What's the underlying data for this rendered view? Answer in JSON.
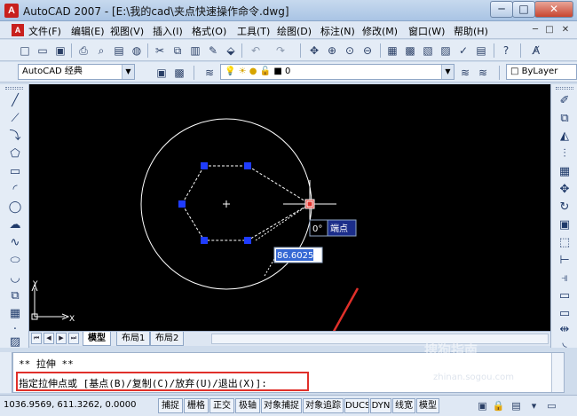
{
  "window": {
    "title": "AutoCAD 2007 - [E:\\我的cad\\夹点快速操作命令.dwg]",
    "logo": "A",
    "minimize": "─",
    "maximize": "□",
    "close": "✕"
  },
  "menubar": {
    "doc_icon": "A",
    "items": [
      "文件(F)",
      "编辑(E)",
      "视图(V)",
      "插入(I)",
      "格式(O)",
      "工具(T)",
      "绘图(D)",
      "标注(N)",
      "修改(M)",
      "窗口(W)",
      "帮助(H)"
    ],
    "mdi_minimize": "─",
    "mdi_restore": "□",
    "mdi_close": "✕"
  },
  "toolbar2": {
    "workspace": "AutoCAD 经典",
    "layer": "0",
    "linetype": "ByLayer"
  },
  "drawing": {
    "dimension_value": "86.6025",
    "angle_value": "0°",
    "snap_tooltip": "端点",
    "ucs_x": "X",
    "ucs_y": "Y"
  },
  "layout_tabs": [
    "模型",
    "布局1",
    "布局2"
  ],
  "command": {
    "line1": "** 拉伸 **",
    "line2": "指定拉伸点或 [基点(B)/复制(C)/放弃(U)/退出(X)]:"
  },
  "status": {
    "coords": "1036.9569, 611.3262, 0.0000",
    "buttons": [
      "捕捉",
      "栅格",
      "正交",
      "极轴",
      "对象捕捉",
      "对象追踪",
      "DUCS",
      "DYN",
      "线宽",
      "模型"
    ]
  },
  "watermark": {
    "text": "搜狗指南",
    "sub": "zhinan.sogou.com"
  },
  "colors": {
    "grip_hot": "#e0302a",
    "grip_cold": "#1f3cff",
    "highlight": "#e0302a"
  }
}
